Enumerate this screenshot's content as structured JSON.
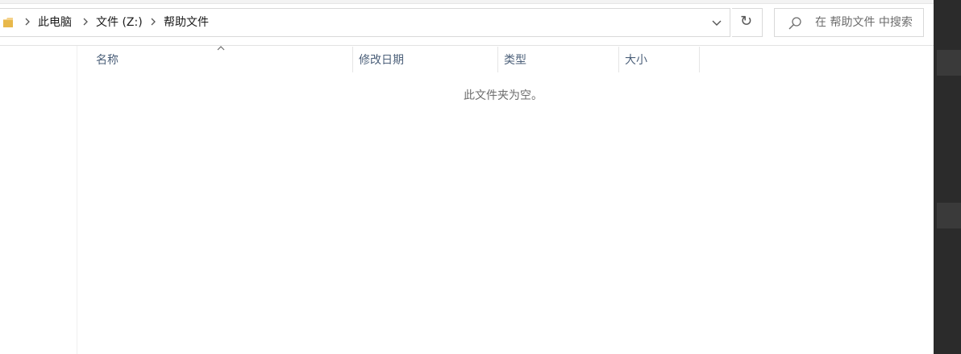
{
  "breadcrumb": {
    "items": [
      {
        "label": "此电脑"
      },
      {
        "label": "文件 (Z:)"
      },
      {
        "label": "帮助文件"
      }
    ]
  },
  "search": {
    "placeholder": "在 帮助文件 中搜索"
  },
  "columns": [
    {
      "label": "名称",
      "sorted": "ascending"
    },
    {
      "label": "修改日期"
    },
    {
      "label": "类型"
    },
    {
      "label": "大小"
    }
  ],
  "content": {
    "empty_message": "此文件夹为空。"
  },
  "icons": {
    "folder": "folder-icon",
    "chevron": "chevron-right-icon",
    "dropdown": "chevron-down-icon",
    "refresh": "refresh-icon",
    "search": "search-icon",
    "sort": "sort-ascending-icon"
  },
  "colors": {
    "folder": "#e8b84a",
    "header_text": "#4c607a",
    "muted_text": "#6d6d6d",
    "side_panel": "#2b2b2b"
  }
}
